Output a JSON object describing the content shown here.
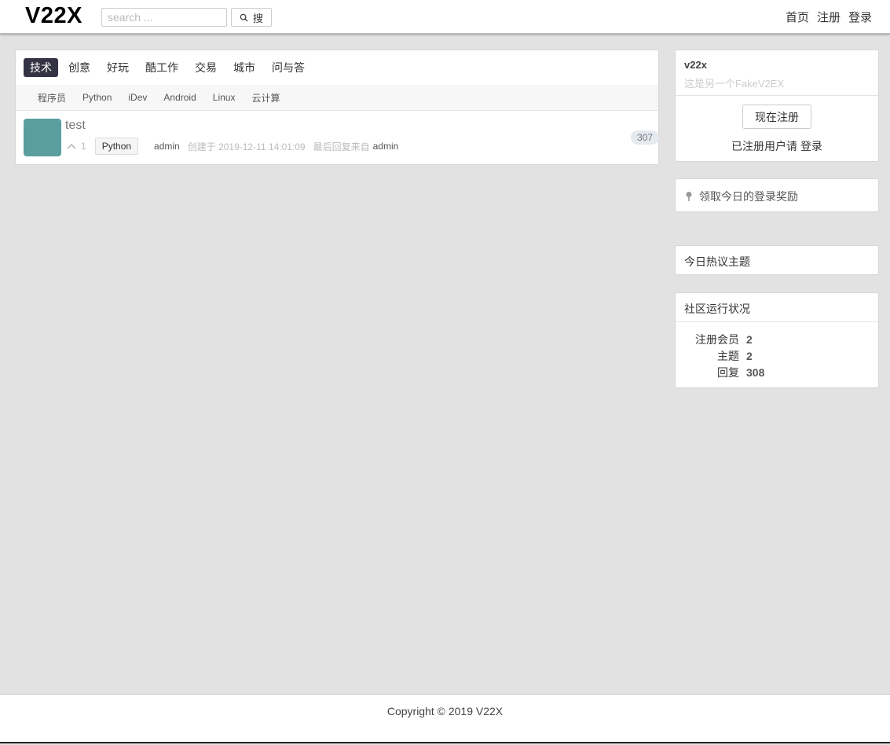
{
  "header": {
    "logo": "V22X",
    "search_placeholder": "search ...",
    "search_button": "搜",
    "nav": [
      "首页",
      "注册",
      "登录"
    ]
  },
  "tabs": {
    "items": [
      "技术",
      "创意",
      "好玩",
      "酷工作",
      "交易",
      "城市",
      "问与答"
    ],
    "active_index": 0
  },
  "subtabs": [
    "程序员",
    "Python",
    "iDev",
    "Android",
    "Linux",
    "云计算"
  ],
  "topic": {
    "title": "test",
    "votes": "1",
    "node": "Python",
    "author": "admin",
    "created": "创建于 2019-12-11 14:01:09",
    "last_reply_label": "最后回复来自",
    "last_reply_user": "admin",
    "reply_count": "307",
    "avatar_color": "#5b9ea0"
  },
  "sidebar": {
    "site_name": "v22x",
    "site_desc": "这是另一个FakeV2EX",
    "register_button": "现在注册",
    "login_hint_prefix": "已注册用户请",
    "login_link": "登录",
    "bonus_link": "领取今日的登录奖励",
    "hot_title": "今日热议主题",
    "stats_title": "社区运行状况",
    "stats": [
      {
        "label": "注册会员",
        "value": "2"
      },
      {
        "label": "主题",
        "value": "2"
      },
      {
        "label": "回复",
        "value": "308"
      }
    ]
  },
  "footer": {
    "copyright": "Copyright © 2019 V22X"
  },
  "colors": {
    "page_bg": "#e2e2e2",
    "active_tab_bg": "#333344",
    "reply_badge_bg": "#e5e9f0"
  }
}
